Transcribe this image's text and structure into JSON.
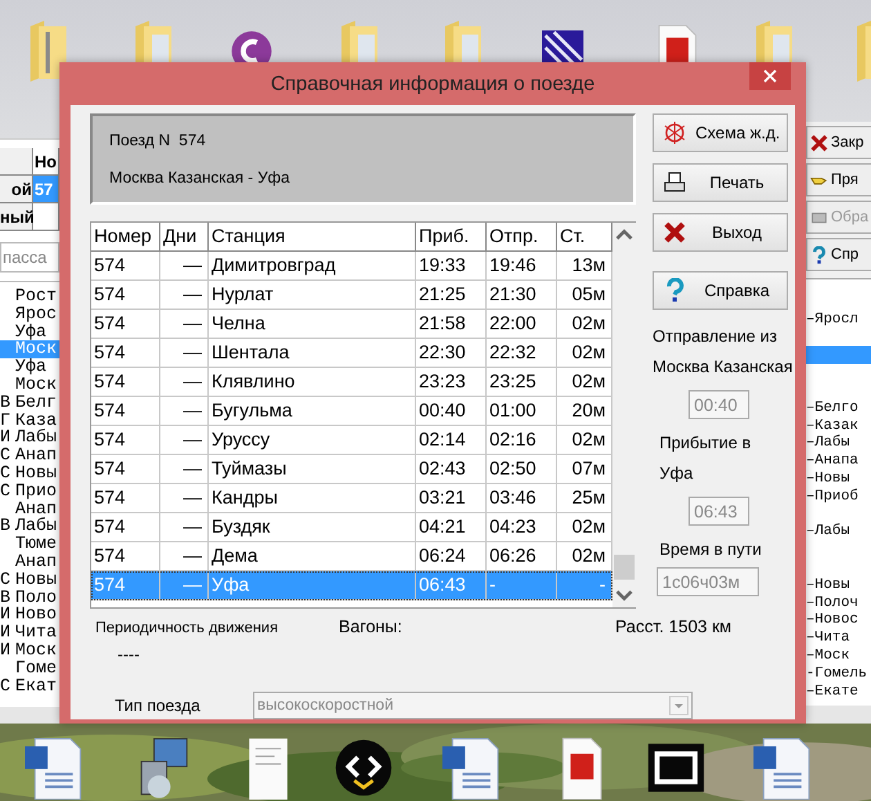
{
  "dialog": {
    "title": "Справочная информация о поезде",
    "train_number": "Поезд N  574",
    "route": "Москва Казанская - Уфа",
    "buttons": [
      {
        "label": "Схема ж.д.",
        "kind": "map"
      },
      {
        "label": "Печать",
        "kind": "print"
      },
      {
        "label": "Выход",
        "kind": "exit"
      },
      {
        "label": "Справка",
        "kind": "help"
      }
    ],
    "table": {
      "columns": [
        "Номер",
        "Дни",
        "Станция",
        "Приб.",
        "Отпр.",
        "Ст."
      ],
      "rows": [
        {
          "number": "574",
          "days": "—",
          "station": "Димитровград",
          "arrival": "19:33",
          "departure": "19:46",
          "stop": "13м",
          "selected": false
        },
        {
          "number": "574",
          "days": "—",
          "station": "Нурлат",
          "arrival": "21:25",
          "departure": "21:30",
          "stop": "05м",
          "selected": false
        },
        {
          "number": "574",
          "days": "—",
          "station": "Челна",
          "arrival": "21:58",
          "departure": "22:00",
          "stop": "02м",
          "selected": false
        },
        {
          "number": "574",
          "days": "—",
          "station": "Шентала",
          "arrival": "22:30",
          "departure": "22:32",
          "stop": "02м",
          "selected": false
        },
        {
          "number": "574",
          "days": "—",
          "station": "Клявлино",
          "arrival": "23:23",
          "departure": "23:25",
          "stop": "02м",
          "selected": false
        },
        {
          "number": "574",
          "days": "—",
          "station": "Бугульма",
          "arrival": "00:40",
          "departure": "01:00",
          "stop": "20м",
          "selected": false
        },
        {
          "number": "574",
          "days": "—",
          "station": "Уруссу",
          "arrival": "02:14",
          "departure": "02:16",
          "stop": "02м",
          "selected": false
        },
        {
          "number": "574",
          "days": "—",
          "station": "Туймазы",
          "arrival": "02:43",
          "departure": "02:50",
          "stop": "07м",
          "selected": false
        },
        {
          "number": "574",
          "days": "—",
          "station": "Кандры",
          "arrival": "03:21",
          "departure": "03:46",
          "stop": "25м",
          "selected": false
        },
        {
          "number": "574",
          "days": "—",
          "station": "Буздяк",
          "arrival": "04:21",
          "departure": "04:23",
          "stop": "02м",
          "selected": false
        },
        {
          "number": "574",
          "days": "—",
          "station": "Дема",
          "arrival": "06:24",
          "departure": "06:26",
          "stop": "02м",
          "selected": false
        },
        {
          "number": "574",
          "days": "—",
          "station": "Уфа",
          "arrival": "06:43",
          "departure": "-",
          "stop": "-",
          "selected": true
        }
      ]
    },
    "departure_label": "Отправление из",
    "departure_station": "Москва Казанская",
    "departure_time": "00:40",
    "arrival_label": "Прибытие в",
    "arrival_station": "Уфа",
    "arrival_time": "06:43",
    "travel_label": "Время в пути",
    "travel_time": "1с06ч03м",
    "periodicity_label": "Периодичность движения",
    "periodicity": "----",
    "cars_label": "Вагоны:",
    "distance": "Расст. 1503 км",
    "train_type_label": "Тип поезда",
    "train_type": {
      "value": "высокоскоростной",
      "disabled": true
    }
  },
  "left_window": {
    "header_cell": "Но",
    "grid_rows": [
      {
        "label": "ой",
        "value": "57",
        "selected": true
      },
      {
        "label": "ный",
        "selected": false
      }
    ],
    "search": {
      "placeholder": "пасса"
    },
    "list": [
      {
        "name": "Рост",
        "selected": false
      },
      {
        "name": "Ярос",
        "selected": false
      },
      {
        "name": "Уфа",
        "selected": false
      },
      {
        "name": "Моск",
        "selected": true
      },
      {
        "name": "Уфа",
        "selected": false
      },
      {
        "name": "Моск",
        "selected": false
      },
      {
        "mark": "В",
        "name": "Белг",
        "selected": false
      },
      {
        "mark": "Г",
        "name": "Каза",
        "selected": false
      },
      {
        "mark": "И",
        "name": "Лабы",
        "selected": false
      },
      {
        "mark": "С",
        "name": "Анап",
        "selected": false
      },
      {
        "mark": "С",
        "name": "Новы",
        "selected": false
      },
      {
        "mark": "С",
        "name": "Прио",
        "selected": false
      },
      {
        "name": "Анап",
        "selected": false
      },
      {
        "mark": "В",
        "name": "Лабы",
        "selected": false
      },
      {
        "name": "Тюме",
        "selected": false
      },
      {
        "name": "Анап",
        "selected": false
      },
      {
        "mark": "С",
        "name": "Новы",
        "selected": false
      },
      {
        "mark": "В",
        "name": "Поло",
        "selected": false
      },
      {
        "mark": "И",
        "name": "Ново",
        "selected": false
      },
      {
        "mark": "И",
        "name": "Чита",
        "selected": false
      },
      {
        "mark": "И",
        "name": "Моск",
        "selected": false
      },
      {
        "name": "Гоме",
        "selected": false
      },
      {
        "mark": "С",
        "name": "Екат",
        "selected": false
      }
    ]
  },
  "right_window": {
    "buttons": [
      {
        "label": "Закр",
        "kind": "close",
        "disabled": false
      },
      {
        "label": "Пря",
        "kind": "hand",
        "disabled": false
      },
      {
        "label": "Обра",
        "kind": "tool",
        "disabled": true
      },
      {
        "label": "Спр",
        "kind": "help",
        "disabled": false
      }
    ],
    "list": [
      {
        "selected": false
      },
      {
        "text": "–Яросл",
        "selected": false
      },
      {
        "selected": false
      },
      {
        "selected": true
      },
      {
        "selected": false
      },
      {
        "selected": false
      },
      {
        "text": "–Белго",
        "selected": false
      },
      {
        "text": "–Казак",
        "selected": false
      },
      {
        "text": "–Лабы",
        "selected": false
      },
      {
        "text": "–Анапа",
        "selected": false
      },
      {
        "text": "–Новы",
        "selected": false
      },
      {
        "text": "–Приоб",
        "selected": false
      },
      {
        "selected": false
      },
      {
        "text": "–Лабы",
        "selected": false
      },
      {
        "selected": false
      },
      {
        "selected": false
      },
      {
        "text": "–Новы",
        "selected": false
      },
      {
        "text": "–Полоч",
        "selected": false
      },
      {
        "text": "–Новос",
        "selected": false
      },
      {
        "text": "–Чита",
        "selected": false
      },
      {
        "text": "–Моск",
        "selected": false
      },
      {
        "text": "-Гомель",
        "selected": false
      },
      {
        "text": "–Екате",
        "selected": false
      }
    ]
  }
}
